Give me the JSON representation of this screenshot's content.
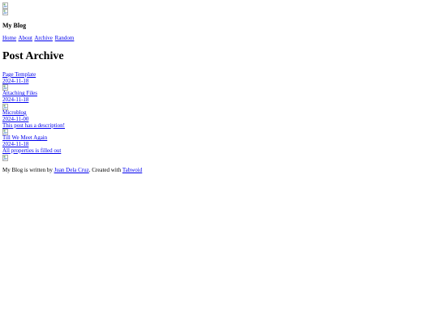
{
  "header": {
    "images": [
      "broken-image-icon",
      "broken-image-icon"
    ],
    "site_title": "My Blog"
  },
  "nav": {
    "items": [
      {
        "label": "Home"
      },
      {
        "label": "About"
      },
      {
        "label": "Archive"
      },
      {
        "label": "Random"
      }
    ]
  },
  "main": {
    "page_title": "Post Archive",
    "posts": [
      {
        "title": "Page Template",
        "date": "2024-11-18",
        "description": ""
      },
      {
        "title": "Attaching Files",
        "date": "2024-11-18",
        "description": ""
      },
      {
        "title": "Microblog",
        "date": "2024-11-00",
        "description": "This post has a description!"
      },
      {
        "title": "Till We Meet Again",
        "date": "2024-11-18",
        "description": "All properties is filled out"
      }
    ]
  },
  "footer": {
    "prefix": "My Blog is written by ",
    "author": "Juan Dela Cruz",
    "middle": ". Created with ",
    "tool": "Tabwoid"
  }
}
